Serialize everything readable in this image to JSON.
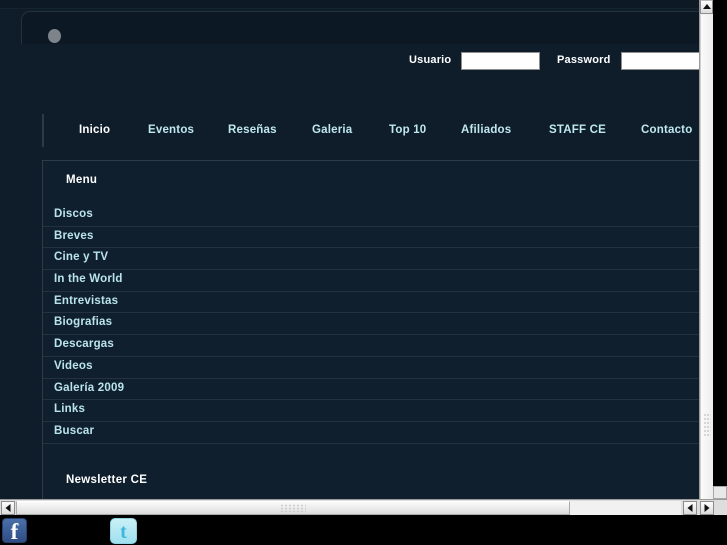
{
  "header": {
    "logo_icon": "broken-image-placeholder"
  },
  "login": {
    "usuario_label": "Usuario",
    "usuario_value": "",
    "usuario_placeholder": "",
    "password_label": "Password",
    "password_value": "",
    "password_placeholder": ""
  },
  "nav": {
    "items": [
      {
        "label": "Inicio",
        "active": true
      },
      {
        "label": "Eventos",
        "active": false
      },
      {
        "label": "Reseñas",
        "active": false
      },
      {
        "label": "Galeria",
        "active": false
      },
      {
        "label": "Top 10",
        "active": false
      },
      {
        "label": "Afiliados",
        "active": false
      },
      {
        "label": "STAFF CE",
        "active": false
      },
      {
        "label": "Contacto",
        "active": false
      }
    ]
  },
  "content": {
    "menu_title": "Menu",
    "menu_items": [
      {
        "label": "Discos"
      },
      {
        "label": "Breves"
      },
      {
        "label": "Cine y TV"
      },
      {
        "label": "In the World"
      },
      {
        "label": "Entrevistas"
      },
      {
        "label": "Biografias"
      },
      {
        "label": "Descargas"
      },
      {
        "label": "Videos"
      },
      {
        "label": "Galería 2009"
      },
      {
        "label": "Links"
      },
      {
        "label": "Buscar"
      }
    ],
    "newsletter_title": "Newsletter CE"
  },
  "social": {
    "facebook_glyph": "f",
    "facebook_name": "facebook-icon",
    "twitter_glyph": "t",
    "twitter_name": "twitter-icon"
  },
  "scrollbars": {
    "v_up_arrow": "▲",
    "h_left_arrow": "◀",
    "h_right_arrow": "▶"
  },
  "colors": {
    "page_bg": "#0f1d2b",
    "panel_bg": "#101f2d",
    "link": "#b9e4ec",
    "active_nav": "#ffffff",
    "separator": "#24323f",
    "facebook": "#3b5998",
    "twitter": "#9fe0ef"
  }
}
